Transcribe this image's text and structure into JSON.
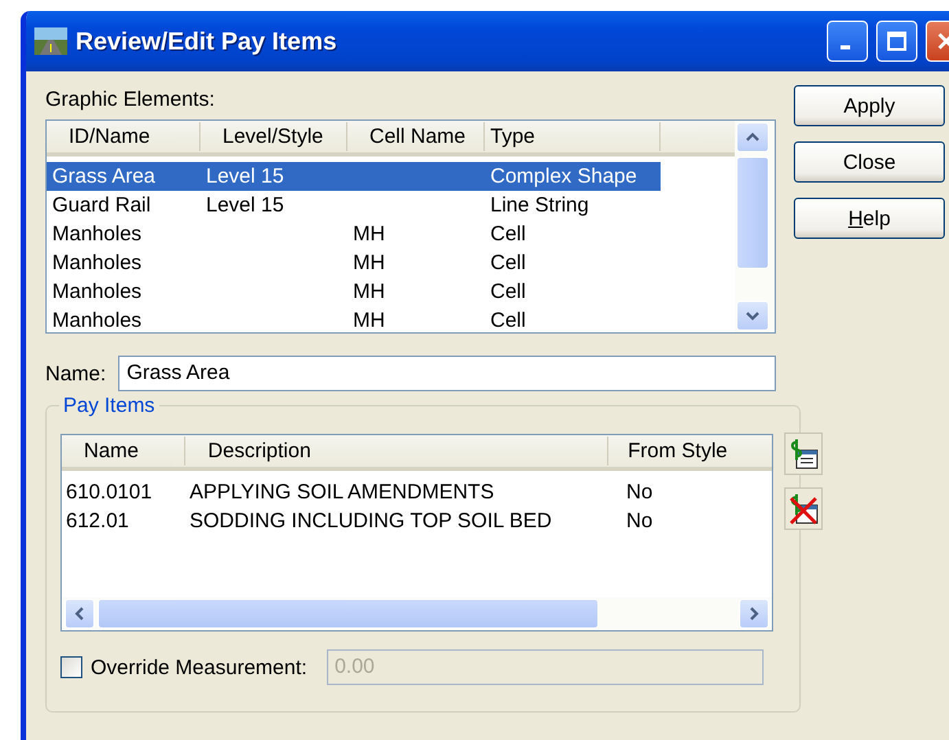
{
  "window": {
    "title": "Review/Edit Pay Items"
  },
  "graphic_elements": {
    "label": "Graphic Elements:",
    "columns": [
      "ID/Name",
      "Level/Style",
      "Cell Name",
      "Type"
    ],
    "rows": [
      {
        "cells": [
          "Grass Area",
          "Level 15",
          "",
          "Complex Shape"
        ],
        "selected": true
      },
      {
        "cells": [
          "Guard Rail",
          "Level 15",
          "",
          "Line String"
        ],
        "selected": false
      },
      {
        "cells": [
          "Manholes",
          "",
          "MH",
          "Cell"
        ],
        "selected": false
      },
      {
        "cells": [
          "Manholes",
          "",
          "MH",
          "Cell"
        ],
        "selected": false
      },
      {
        "cells": [
          "Manholes",
          "",
          "MH",
          "Cell"
        ],
        "selected": false
      },
      {
        "cells": [
          "Manholes",
          "",
          "MH",
          "Cell"
        ],
        "selected": false
      }
    ]
  },
  "name_field": {
    "label": "Name:",
    "value": "Grass Area"
  },
  "pay_items": {
    "title": "Pay Items",
    "columns": [
      "Name",
      "Description",
      "From Style"
    ],
    "rows": [
      {
        "cells": [
          "610.0101",
          "APPLYING SOIL AMENDMENTS",
          "No"
        ],
        "selected": false
      },
      {
        "cells": [
          "612.01",
          "SODDING INCLUDING TOP SOIL BED",
          "No"
        ],
        "selected": false
      }
    ],
    "override": {
      "label": "Override Measurement:",
      "checked": false,
      "value": "0.00",
      "disabled": true
    }
  },
  "buttons": [
    {
      "label": "Apply",
      "mnemonic": false
    },
    {
      "label": "Close",
      "mnemonic": false
    },
    {
      "label": "Help",
      "mnemonic": true
    }
  ]
}
